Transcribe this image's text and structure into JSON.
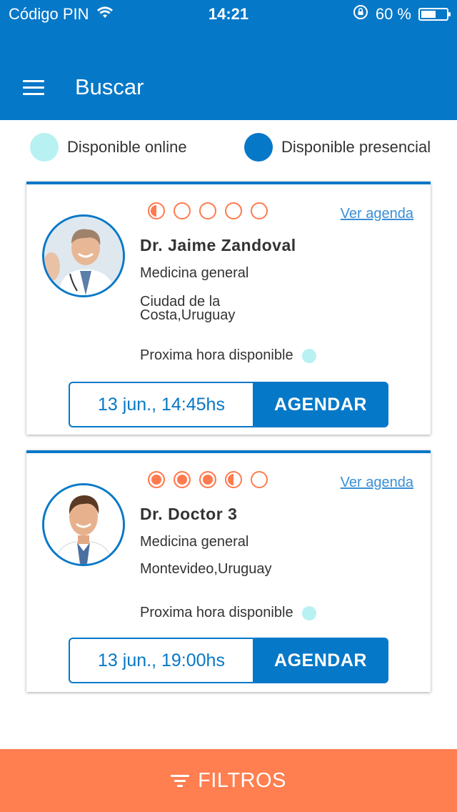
{
  "status_bar": {
    "carrier": "Código PIN",
    "time": "14:21",
    "battery_text": "60 %",
    "battery_level": 0.6
  },
  "app_bar": {
    "title": "Buscar",
    "menu_icon": "hamburger-menu-icon"
  },
  "legend": {
    "online_label": "Disponible online",
    "online_color": "#b8f1f1",
    "presencial_label": "Disponible presencial",
    "presencial_color": "#0678c8"
  },
  "doctors": [
    {
      "name": "Dr. Jaime Zandoval",
      "specialty": "Medicina general",
      "location": "Ciudad de la Costa,Uruguay",
      "rating": 0.5,
      "ver_agenda_label": "Ver agenda",
      "next_label": "Proxima hora disponible",
      "next_availability": "online",
      "slot_time": "13 jun., 14:45hs",
      "agendar_label": "AGENDAR"
    },
    {
      "name": "Dr. Doctor 3",
      "specialty": "Medicina general",
      "location": "Montevideo,Uruguay",
      "rating": 3.5,
      "ver_agenda_label": "Ver agenda",
      "next_label": "Proxima hora disponible",
      "next_availability": "online",
      "slot_time": "13 jun., 19:00hs",
      "agendar_label": "AGENDAR"
    }
  ],
  "bottom_bar": {
    "label": "FILTROS",
    "icon": "filter-icon"
  }
}
